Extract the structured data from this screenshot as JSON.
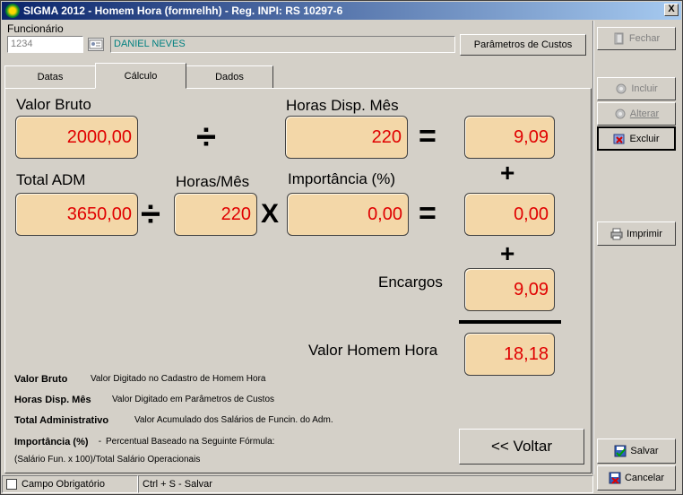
{
  "window": {
    "title": "SIGMA 2012 - Homem Hora  (formrelhh) - Reg. INPI: RS 10297-6",
    "close_label": "X"
  },
  "header": {
    "funcionario_label": "Funcionário",
    "funcionario_code": "1234",
    "funcionario_name": "DANIEL NEVES",
    "parametros_button": "Parâmetros de Custos"
  },
  "tabs": [
    {
      "label": "Datas"
    },
    {
      "label": "Cálculo"
    },
    {
      "label": "Dados"
    }
  ],
  "calc": {
    "valor_bruto_label": "Valor Bruto",
    "valor_bruto": "2000,00",
    "horas_disp_label": "Horas Disp. Mês",
    "horas_disp": "220",
    "result1": "9,09",
    "total_adm_label": "Total ADM",
    "total_adm": "3650,00",
    "horas_mes_label": "Horas/Mês",
    "horas_mes": "220",
    "importancia_label": "Importância (%)",
    "importancia": "0,00",
    "result2": "0,00",
    "encargos_label": "Encargos",
    "encargos": "9,09",
    "homem_hora_label": "Valor Homem Hora",
    "homem_hora": "18,18",
    "div_symbol": "÷",
    "equals_symbol": "=",
    "plus_symbol": "+",
    "times_symbol": "X"
  },
  "legend": {
    "vb_key": "Valor Bruto",
    "vb_val": "Valor Digitado no Cadastro de Homem Hora",
    "hd_key": "Horas Disp. Mês",
    "hd_val": "Valor Digitado em Parâmetros de Custos",
    "ta_key": "Total Administrativo",
    "ta_val": "Valor Acumulado dos Salários de Funcin. do Adm.",
    "imp_key": "Importância (%)",
    "imp_dash": " - ",
    "imp_val": "Percentual Baseado na Seguinte Fórmula:",
    "formula": "(Salário Fun. x 100)/Total Salário Operacionais"
  },
  "voltar_button": "<< Voltar",
  "side": {
    "fechar": "Fechar",
    "incluir": "Incluir",
    "alterar": "Alterar",
    "excluir": "Excluir",
    "imprimir": "Imprimir",
    "salvar": "Salvar",
    "cancelar": "Cancelar"
  },
  "status": {
    "obrigatorio": "Campo Obrigatório",
    "shortcut": "Ctrl + S - Salvar"
  },
  "colors": {
    "value_text": "#e00000",
    "value_bg": "#f3d7a8",
    "title_gradient_start": "#0a246a"
  }
}
